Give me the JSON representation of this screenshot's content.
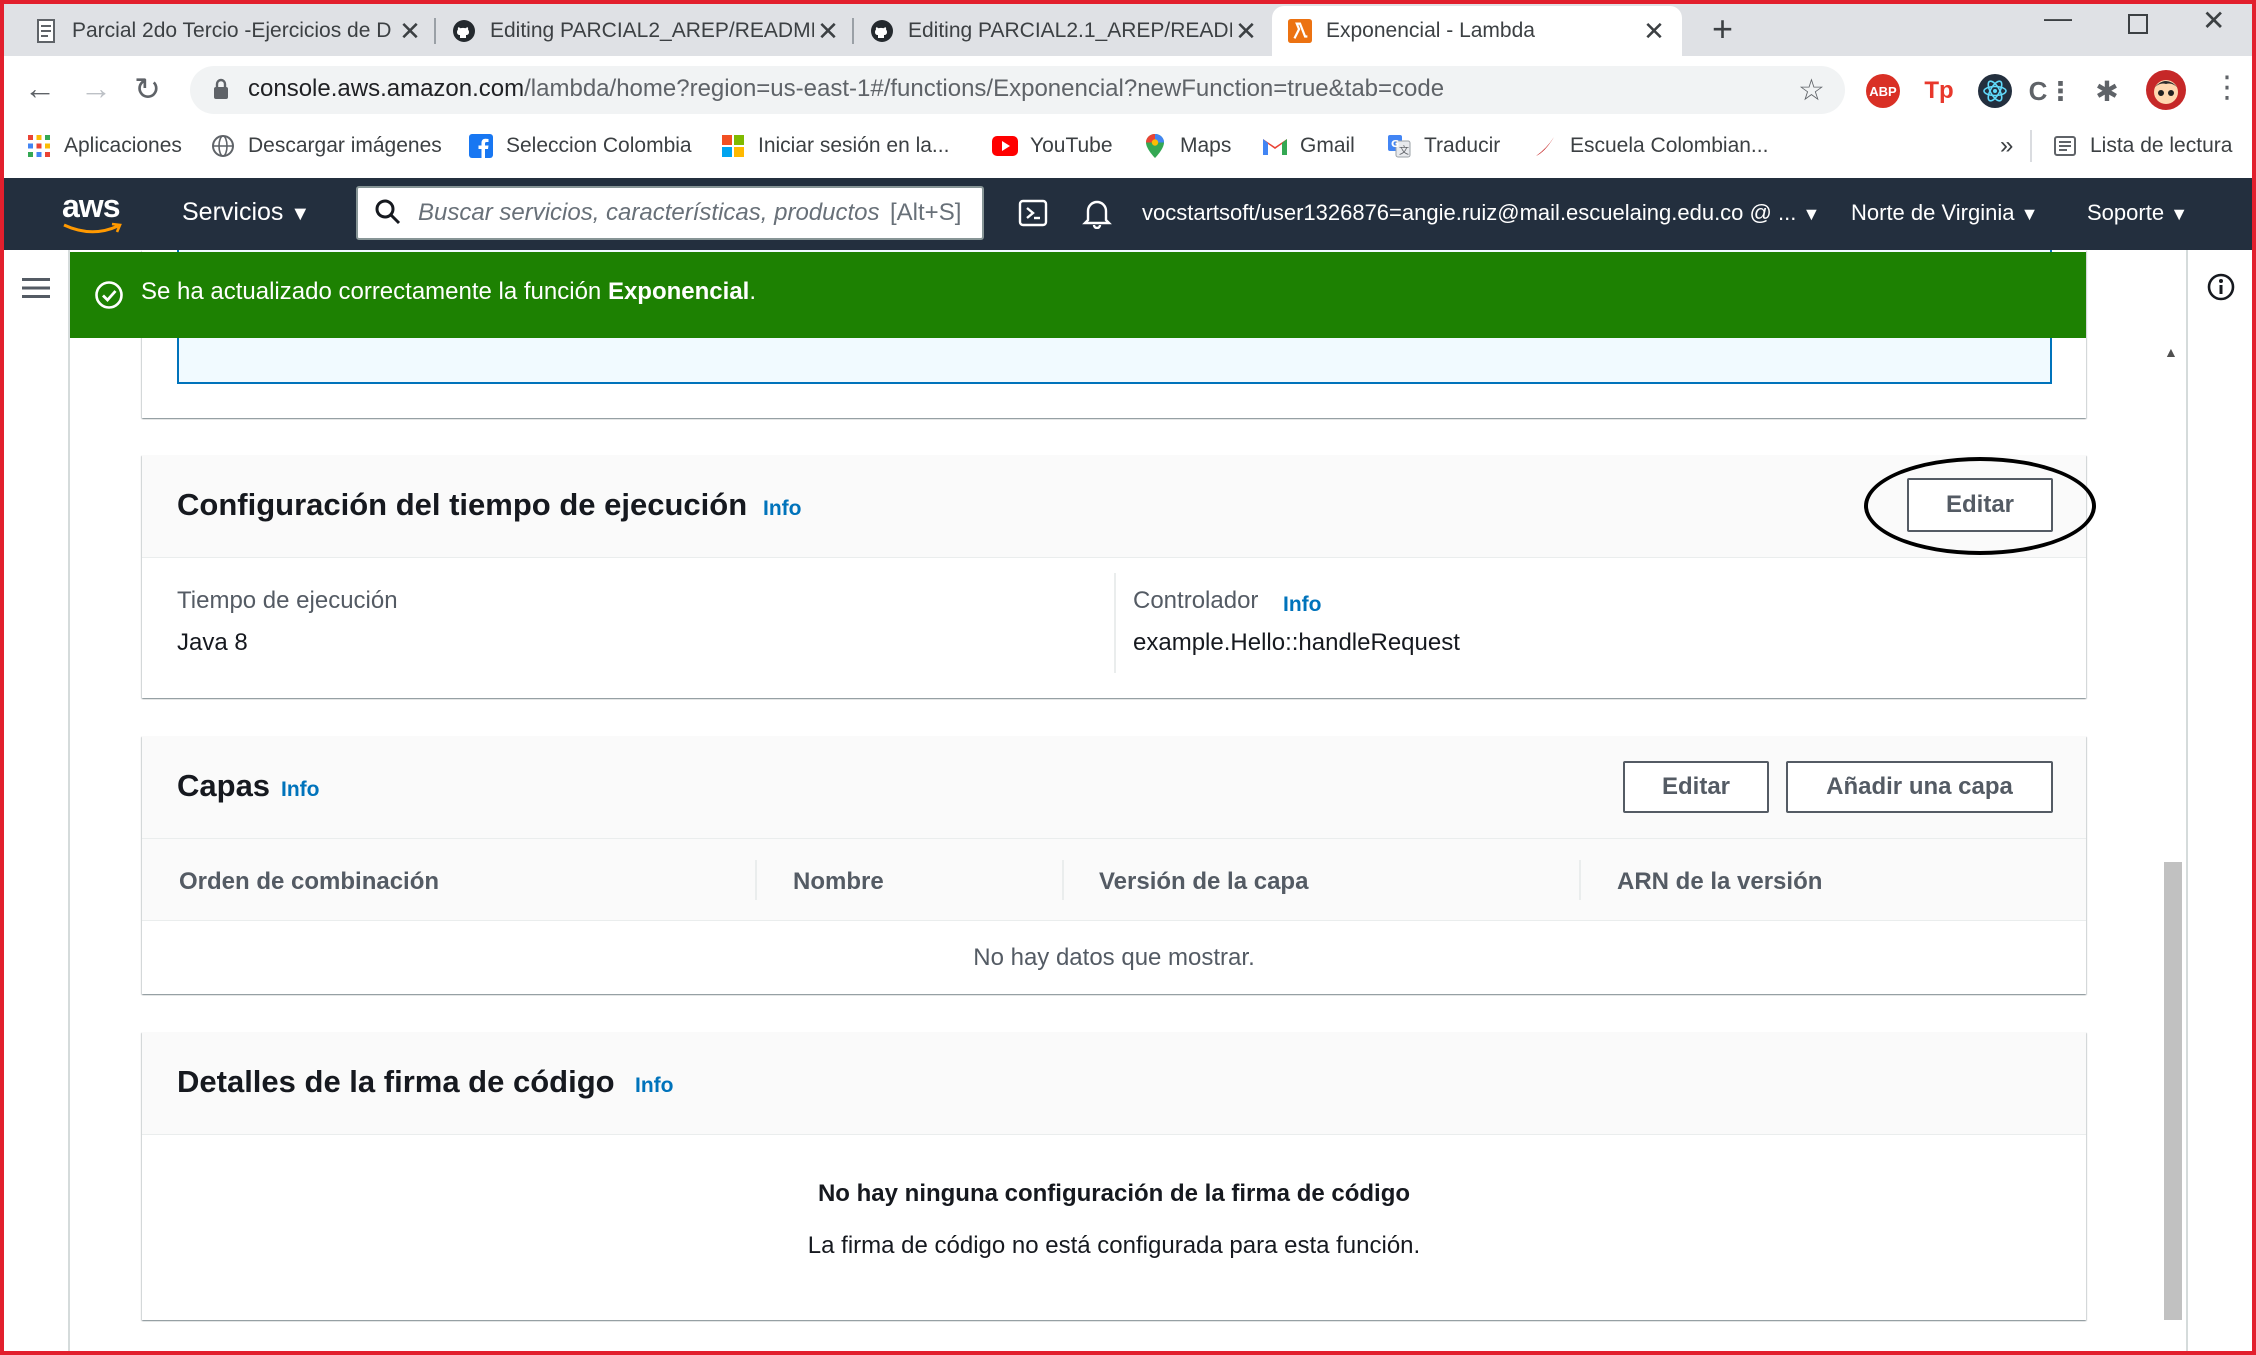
{
  "browser": {
    "tabs": [
      {
        "label": "Parcial 2do Tercio -Ejercicios de D",
        "icon": "document-icon"
      },
      {
        "label": "Editing PARCIAL2_AREP/README",
        "icon": "github-icon"
      },
      {
        "label": "Editing PARCIAL2.1_AREP/READM",
        "icon": "github-icon"
      },
      {
        "label": "Exponencial - Lambda",
        "icon": "lambda-icon",
        "active": true
      }
    ],
    "url_host": "console.aws.amazon.com",
    "url_path": "/lambda/home?region=us-east-1#/functions/Exponencial?newFunction=true&tab=code",
    "bookmarks": [
      {
        "label": "Aplicaciones",
        "icon": "apps-grid-icon"
      },
      {
        "label": "Descargar imágenes",
        "icon": "globe-icon"
      },
      {
        "label": "Seleccion Colombia",
        "icon": "facebook-icon"
      },
      {
        "label": "Iniciar sesión en la...",
        "icon": "microsoft-icon"
      },
      {
        "label": "YouTube",
        "icon": "youtube-icon"
      },
      {
        "label": "Maps",
        "icon": "maps-pin-icon"
      },
      {
        "label": "Gmail",
        "icon": "gmail-icon"
      },
      {
        "label": "Traducir",
        "icon": "translate-icon"
      },
      {
        "label": "Escuela Colombian...",
        "icon": "school-icon"
      }
    ],
    "overflow_label": "»",
    "reading_list": "Lista de lectura",
    "extensions": [
      "ABP",
      "Tp"
    ]
  },
  "aws": {
    "logo": "aws",
    "services": "Servicios",
    "search_placeholder": "Buscar servicios, características, productos",
    "search_shortcut": "[Alt+S]",
    "account": "vocstartsoft/user1326876=angie.ruiz@mail.escuelaing.edu.co @ ...",
    "region": "Norte de Virginia",
    "support": "Soporte"
  },
  "flash": {
    "message_prefix": "Se ha actualizado correctamente la función ",
    "function_name": "Exponencial",
    "message_suffix": "."
  },
  "runtime_settings": {
    "title": "Configuración del tiempo de ejecución",
    "info": "Info",
    "edit": "Editar",
    "runtime_label": "Tiempo de ejecución",
    "runtime_value": "Java 8",
    "handler_label": "Controlador",
    "handler_info": "Info",
    "handler_value": "example.Hello::handleRequest"
  },
  "layers": {
    "title": "Capas",
    "info": "Info",
    "edit": "Editar",
    "add_layer": "Añadir una capa",
    "columns": [
      "Orden de combinación",
      "Nombre",
      "Versión de la capa",
      "ARN de la versión"
    ],
    "empty": "No hay datos que mostrar."
  },
  "code_signing": {
    "title": "Detalles de la firma de código",
    "info": "Info",
    "empty_title": "No hay ninguna configuración de la firma de código",
    "empty_desc": "La firma de código no está configurada para esta función."
  },
  "colors": {
    "aws_nav": "#232f3e",
    "success": "#1d8102",
    "link": "#0073bb",
    "frame": "#e21f2d"
  }
}
